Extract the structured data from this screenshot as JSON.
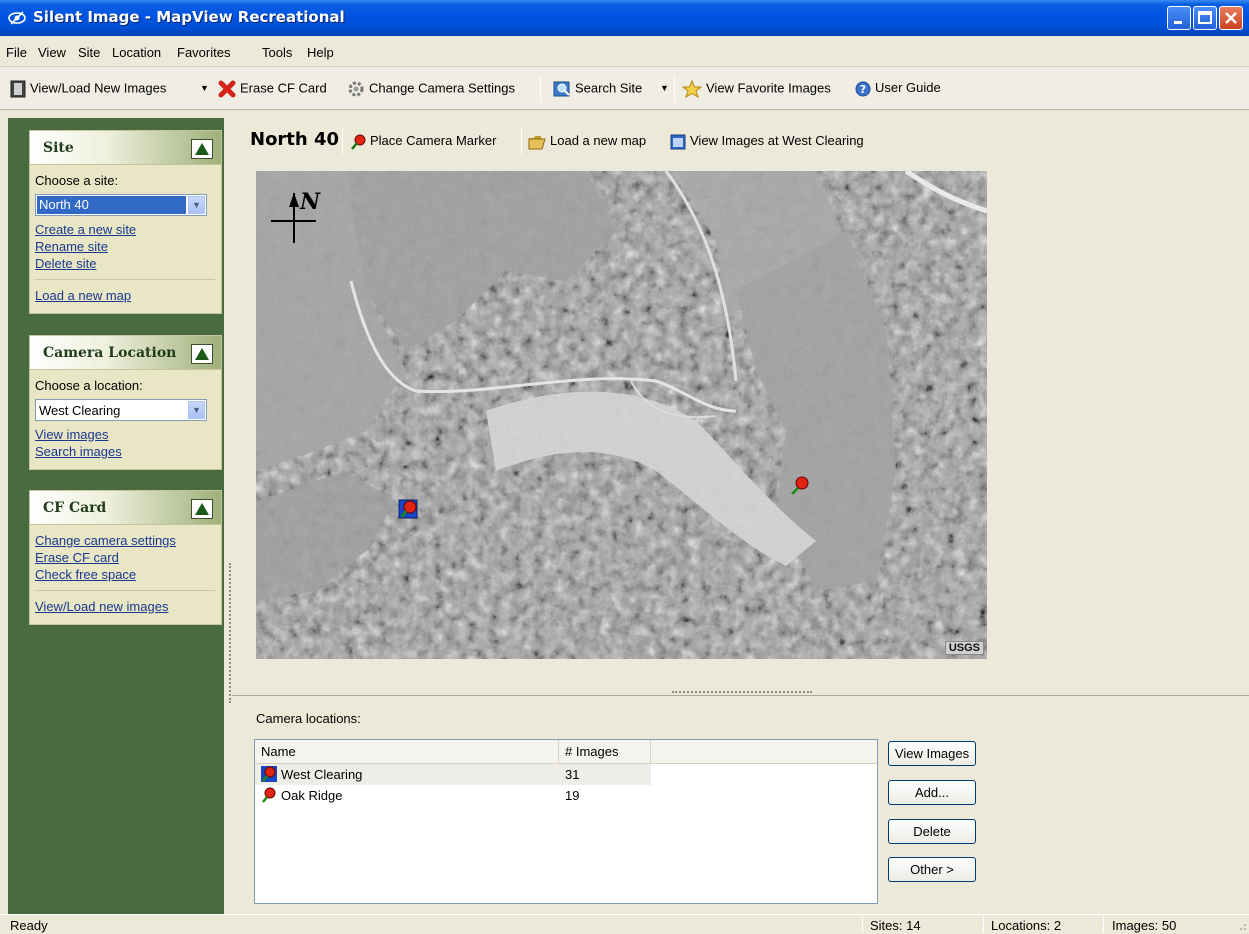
{
  "window": {
    "title": "Silent Image - MapView Recreational",
    "icon": "app-eye-icon"
  },
  "menu": [
    "File",
    "View",
    "Site",
    "Location",
    "Favorites",
    "Tools",
    "Help"
  ],
  "toolbar": {
    "view_load": "View/Load New Images",
    "erase_cf": "Erase CF Card",
    "change_camera": "Change Camera Settings",
    "search_site": "Search Site",
    "view_favorites": "View Favorite Images",
    "user_guide": "User Guide"
  },
  "site_panel": {
    "title": "Site",
    "choose_label": "Choose a site:",
    "selected_site": "North 40",
    "links": [
      "Create a new site",
      "Rename site",
      "Delete site"
    ],
    "load_map": "Load a new map"
  },
  "camera_panel": {
    "title": "Camera Location",
    "choose_label": "Choose a location:",
    "selected_location": "West Clearing",
    "links": [
      "View images",
      "Search images"
    ]
  },
  "cf_panel": {
    "title": "CF Card",
    "links": [
      "Change camera settings",
      "Erase CF card",
      "Check free space"
    ],
    "view_load": "View/Load new images"
  },
  "map_header": {
    "site_name": "North 40",
    "place_marker": "Place Camera Marker",
    "load_map": "Load a new map",
    "view_images_at": "View Images at West Clearing"
  },
  "map": {
    "credit": "USGS",
    "north_label": "N"
  },
  "camera_locations": {
    "label": "Camera locations:",
    "columns": [
      "Name",
      "# Images"
    ],
    "rows": [
      {
        "name": "West Clearing",
        "images": "31"
      },
      {
        "name": "Oak Ridge",
        "images": "19"
      }
    ],
    "buttons": {
      "view_images": "View Images",
      "add": "Add...",
      "delete": "Delete",
      "other": "Other >"
    }
  },
  "status": {
    "ready": "Ready",
    "sites": "Sites: 14",
    "locations": "Locations: 2",
    "images": "Images: 50"
  },
  "colors": {
    "title_blue": "#0054e3",
    "left_pane_green": "#486c40",
    "panel_bg": "#e8e6c4",
    "link_blue": "#1a3890",
    "selection_blue": "#316ac5"
  }
}
